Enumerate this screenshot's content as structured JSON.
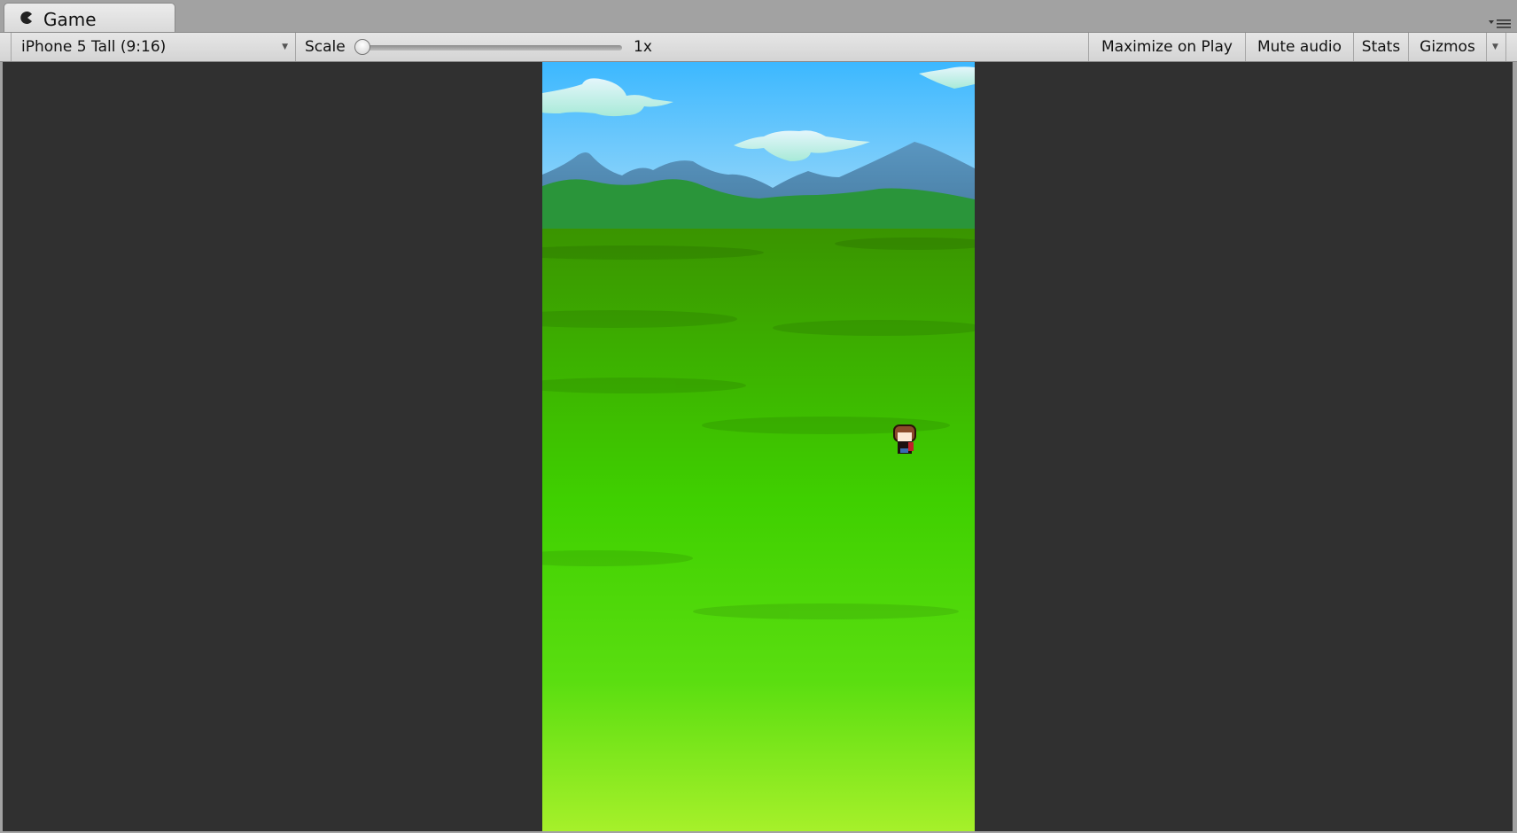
{
  "window": {
    "tab_label": "Game",
    "tab_icon": "pacman-game-icon",
    "menu_icon": "panel-menu-icon"
  },
  "toolbar": {
    "aspect_dropdown": "iPhone 5 Tall (9:16)",
    "scale_label": "Scale",
    "scale_value": "1x",
    "scale_slider_fraction": 0,
    "maximize_on_play": "Maximize on Play",
    "mute_audio": "Mute audio",
    "stats": "Stats",
    "gizmos": "Gizmos"
  },
  "colors": {
    "sky_top": "#3cb8ff",
    "sky_bottom": "#a8dcf8",
    "mountain": "#4a7fa6",
    "grass_top": "#3a9400",
    "grass_bottom": "#a6f02a",
    "viewport_bg": "#303030"
  }
}
